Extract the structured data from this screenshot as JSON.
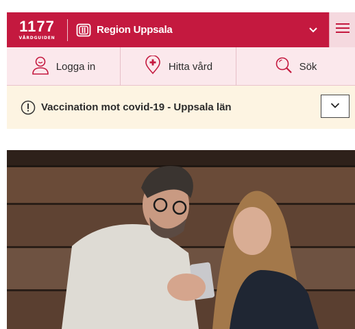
{
  "header": {
    "logo_number": "1177",
    "logo_sub": "VÅRDGUIDEN",
    "region_label": "Region Uppsala",
    "region_icon": "region-uppsala-logo",
    "chevron_icon": "chevron-down-icon",
    "menu_icon": "hamburger-menu-icon",
    "brand_color": "#c4193f"
  },
  "nav": {
    "items": [
      {
        "label": "Logga in",
        "icon": "user-icon"
      },
      {
        "label": "Hitta vård",
        "icon": "location-plus-icon"
      },
      {
        "label": "Sök",
        "icon": "search-icon"
      }
    ],
    "background": "#fbe8ec"
  },
  "alert": {
    "text": "Vaccination mot covid-19 - Uppsala län",
    "icon": "exclamation-circle-icon",
    "toggle_icon": "chevron-down-icon",
    "background": "#fdf4e2"
  },
  "hero": {
    "image": "photo-man-and-girl-looking-at-phone"
  }
}
